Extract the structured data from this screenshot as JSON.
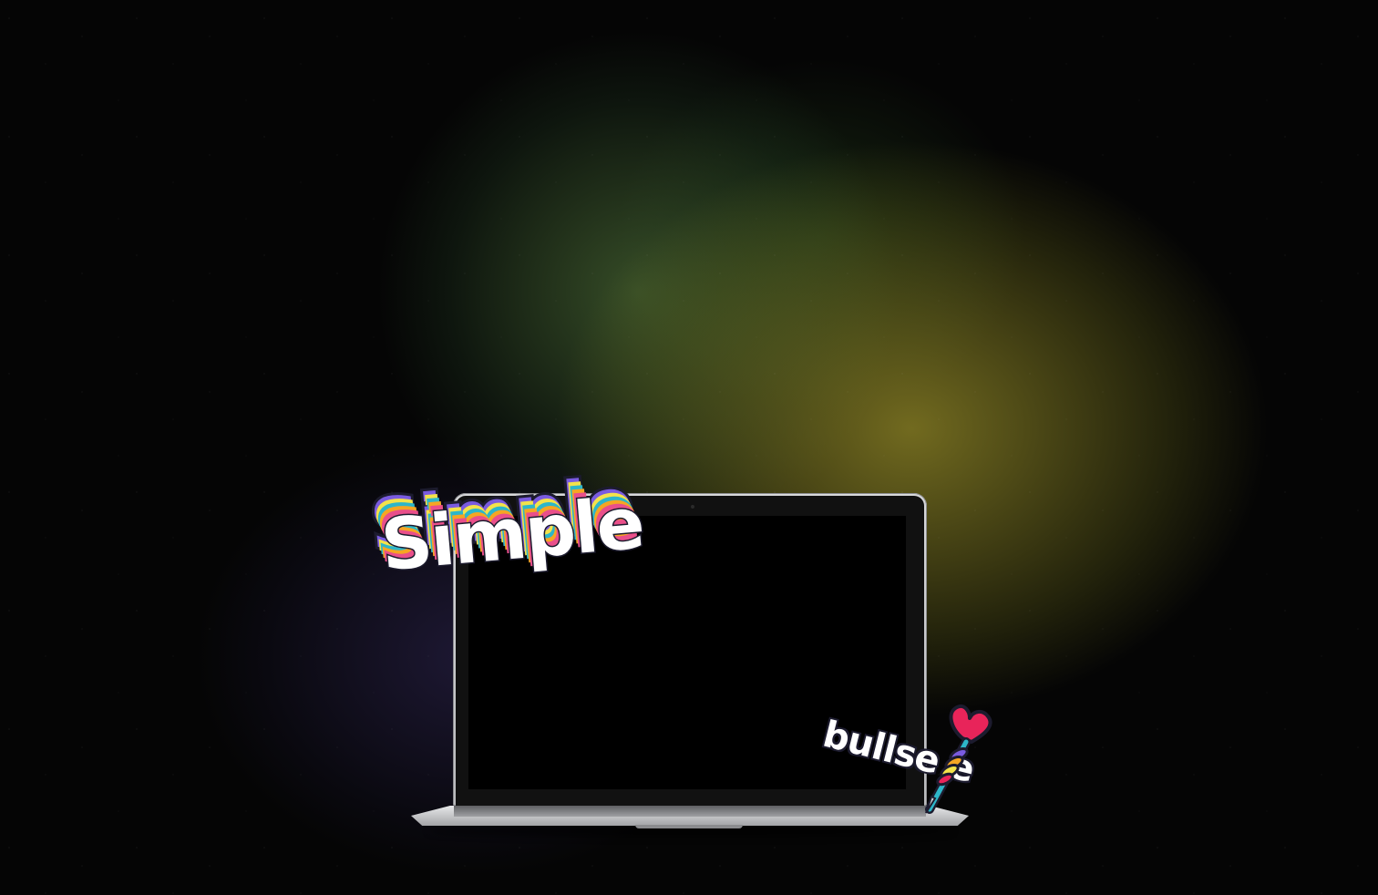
{
  "stickers": {
    "simple": {
      "text": "Simple",
      "layer_colors": [
        "#e94f8a",
        "#f5a623",
        "#2db6c9",
        "#f3e24a",
        "#7a5be0"
      ],
      "fill_color": "#ffffff",
      "outline_color": "#1c1b2e"
    },
    "bullseye": {
      "text": "bullse  e",
      "icon": "dart-icon",
      "fill_color": "#ffffff",
      "outline_color": "#1c1b2e",
      "dart_colors": [
        "#e8245a",
        "#f5a623",
        "#f3e24a",
        "#2db6c9",
        "#7a5be0"
      ]
    }
  },
  "laptop": {
    "screen_color": "#000000",
    "body_color": "#c9cacc"
  }
}
